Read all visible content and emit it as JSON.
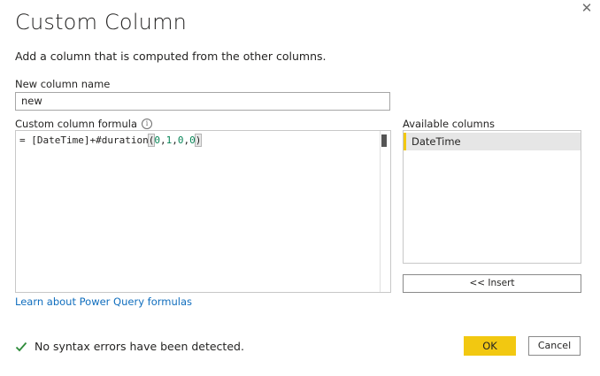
{
  "dialog": {
    "title": "Custom Column",
    "close_icon": "close-icon",
    "subtitle": "Add a column that is computed from the other columns."
  },
  "new_column": {
    "label": "New column name",
    "value": "new"
  },
  "formula": {
    "label": "Custom column formula",
    "info_icon": "info-icon",
    "prefix": "= [DateTime]+#duration",
    "open_paren": "(",
    "args": [
      "0",
      "1",
      "0",
      "0"
    ],
    "close_paren": ")",
    "number_color": "#098658"
  },
  "available_columns": {
    "label": "Available columns",
    "items": [
      "DateTime"
    ],
    "selected_accent": "#f2c811"
  },
  "insert_button": {
    "label": "<< Insert"
  },
  "learn_link": {
    "label": "Learn about Power Query formulas"
  },
  "status": {
    "icon": "checkmark-icon",
    "text": "No syntax errors have been detected.",
    "color": "#2e8b3a"
  },
  "buttons": {
    "ok": "OK",
    "cancel": "Cancel",
    "ok_color": "#f2c811"
  }
}
